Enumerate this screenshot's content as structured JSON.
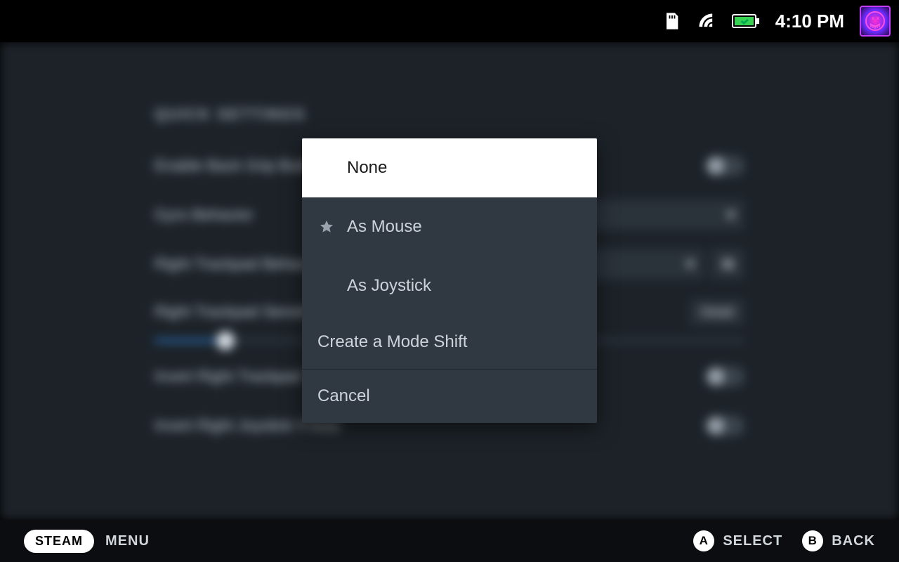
{
  "status": {
    "clock": "4:10 PM"
  },
  "bg": {
    "section": "QUICK SETTINGS",
    "rows": {
      "backgrip": "Enable Back Grip Buttons",
      "gyro": "Gyro Behavior",
      "rtp_behavior": "Right Trackpad Behavior",
      "rtp_sens": "Right Trackpad Sensitivity",
      "detail": "Detail",
      "invert_tp": "Invert Right Trackpad Y-Axis",
      "invert_js": "Invert Right Joystick Y-Axis"
    }
  },
  "modal": {
    "options": {
      "none": "None",
      "mouse": "As Mouse",
      "joystick": "As Joystick",
      "modeshift": "Create a Mode Shift",
      "cancel": "Cancel"
    }
  },
  "footer": {
    "steam": "STEAM",
    "menu": "MENU",
    "a": "A",
    "select": "SELECT",
    "b": "B",
    "back": "BACK"
  }
}
